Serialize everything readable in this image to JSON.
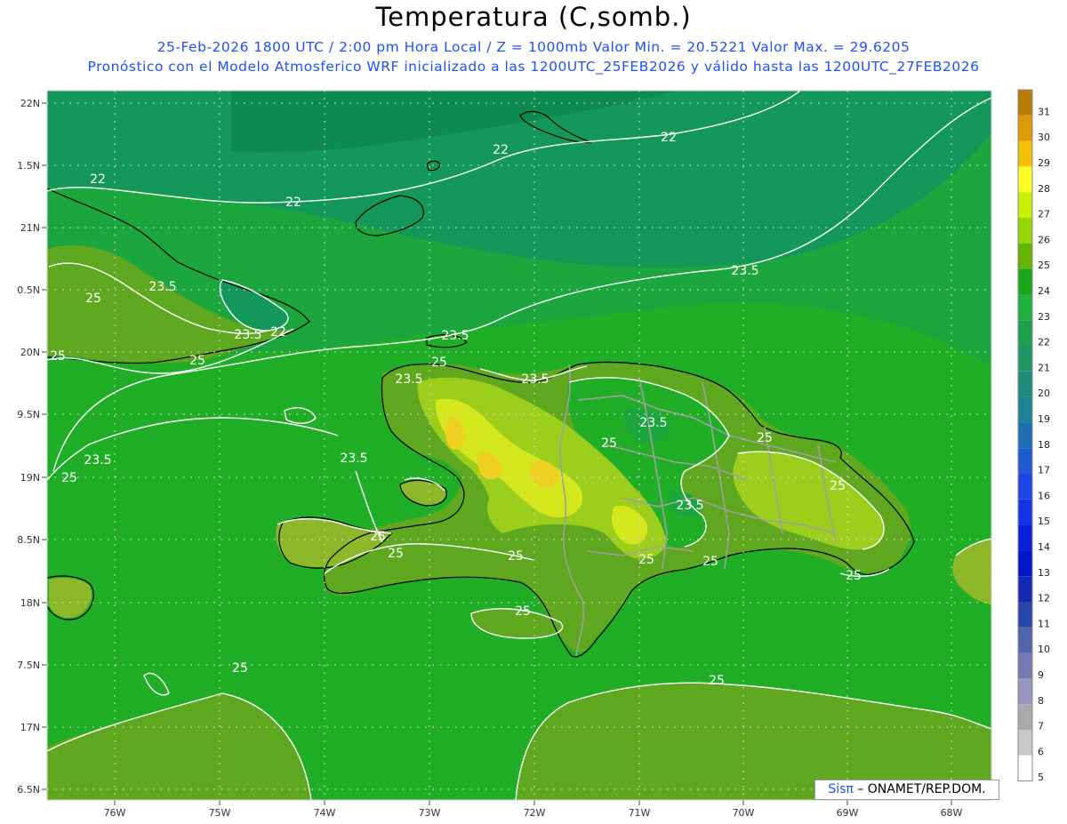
{
  "header": {
    "title": "Temperatura (C,somb.)",
    "subtitle_1": "25-Feb-2026  1800 UTC / 2:00 pm Hora Local / Z = 1000mb   Valor Min. = 20.5221  Valor Max. = 29.6205",
    "subtitle_2": "Pronóstico con el Modelo Atmosferico WRF inicializado a las 1200UTC_25FEB2026 y válido hasta las  1200UTC_27FEB2026"
  },
  "map": {
    "lat_labels": [
      "22N",
      "1.5N",
      "21N",
      "0.5N",
      "20N",
      "9.5N",
      "19N",
      "8.5N",
      "18N",
      "7.5N",
      "17N",
      "6.5N"
    ],
    "lon_labels": [
      "76W",
      "75W",
      "74W",
      "73W",
      "72W",
      "71W",
      "70W",
      "69W",
      "68W"
    ],
    "contour_labels": [
      {
        "text": "22"
      },
      {
        "text": "22"
      },
      {
        "text": "22"
      },
      {
        "text": "22"
      },
      {
        "text": "22"
      },
      {
        "text": "23.5"
      },
      {
        "text": "23.5"
      },
      {
        "text": "23.5"
      },
      {
        "text": "23.5"
      },
      {
        "text": "23.5"
      },
      {
        "text": "23.5"
      },
      {
        "text": "23.5"
      },
      {
        "text": "23.5"
      },
      {
        "text": "23.5"
      },
      {
        "text": "23.5"
      },
      {
        "text": "25"
      },
      {
        "text": "25"
      },
      {
        "text": "25"
      },
      {
        "text": "25"
      },
      {
        "text": "25"
      },
      {
        "text": "25"
      },
      {
        "text": "25"
      },
      {
        "text": "25"
      },
      {
        "text": "25"
      },
      {
        "text": "25"
      },
      {
        "text": "25"
      },
      {
        "text": "25"
      },
      {
        "text": "25"
      },
      {
        "text": "25"
      },
      {
        "text": "25"
      },
      {
        "text": "25"
      },
      {
        "text": "25"
      }
    ],
    "colors": {
      "band_20_21": "#0d8a4f",
      "band_21_22": "#14985a",
      "band_22_23": "#1ca63e",
      "band_23_24": "#20ae26",
      "band_24_25": "#5fa81f",
      "band_25_26": "#8cb82a",
      "band_26_27": "#9ccf1c",
      "band_27_28": "#d4e81c",
      "band_28_29": "#f0d020",
      "coastline": "#000000",
      "borders": "#a0a0a0",
      "contour": "#ffffff"
    }
  },
  "colorbar": {
    "levels": [
      "31",
      "30",
      "29",
      "28",
      "27",
      "26",
      "25",
      "24",
      "23",
      "22",
      "21",
      "20",
      "19",
      "18",
      "17",
      "16",
      "15",
      "14",
      "13",
      "12",
      "11",
      "10",
      "9",
      "8",
      "7",
      "6",
      "5"
    ],
    "colors": [
      "#b87a00",
      "#e09a00",
      "#f5c000",
      "#ffff28",
      "#c8f000",
      "#96d600",
      "#64b400",
      "#1aa61a",
      "#1eb43c",
      "#1ea050",
      "#1e9664",
      "#1e8c78",
      "#1e8296",
      "#1e6eb4",
      "#1e5ad2",
      "#1e46e6",
      "#1432e6",
      "#0a1edc",
      "#0014c8",
      "#1428b4",
      "#2846aa",
      "#5064aa",
      "#7878b4",
      "#9696be",
      "#aaaaaa",
      "#c8c8c8",
      "#ffffff"
    ]
  },
  "credit": {
    "brand": "Sisπ",
    "org": " – ONAMET/REP.DOM."
  }
}
